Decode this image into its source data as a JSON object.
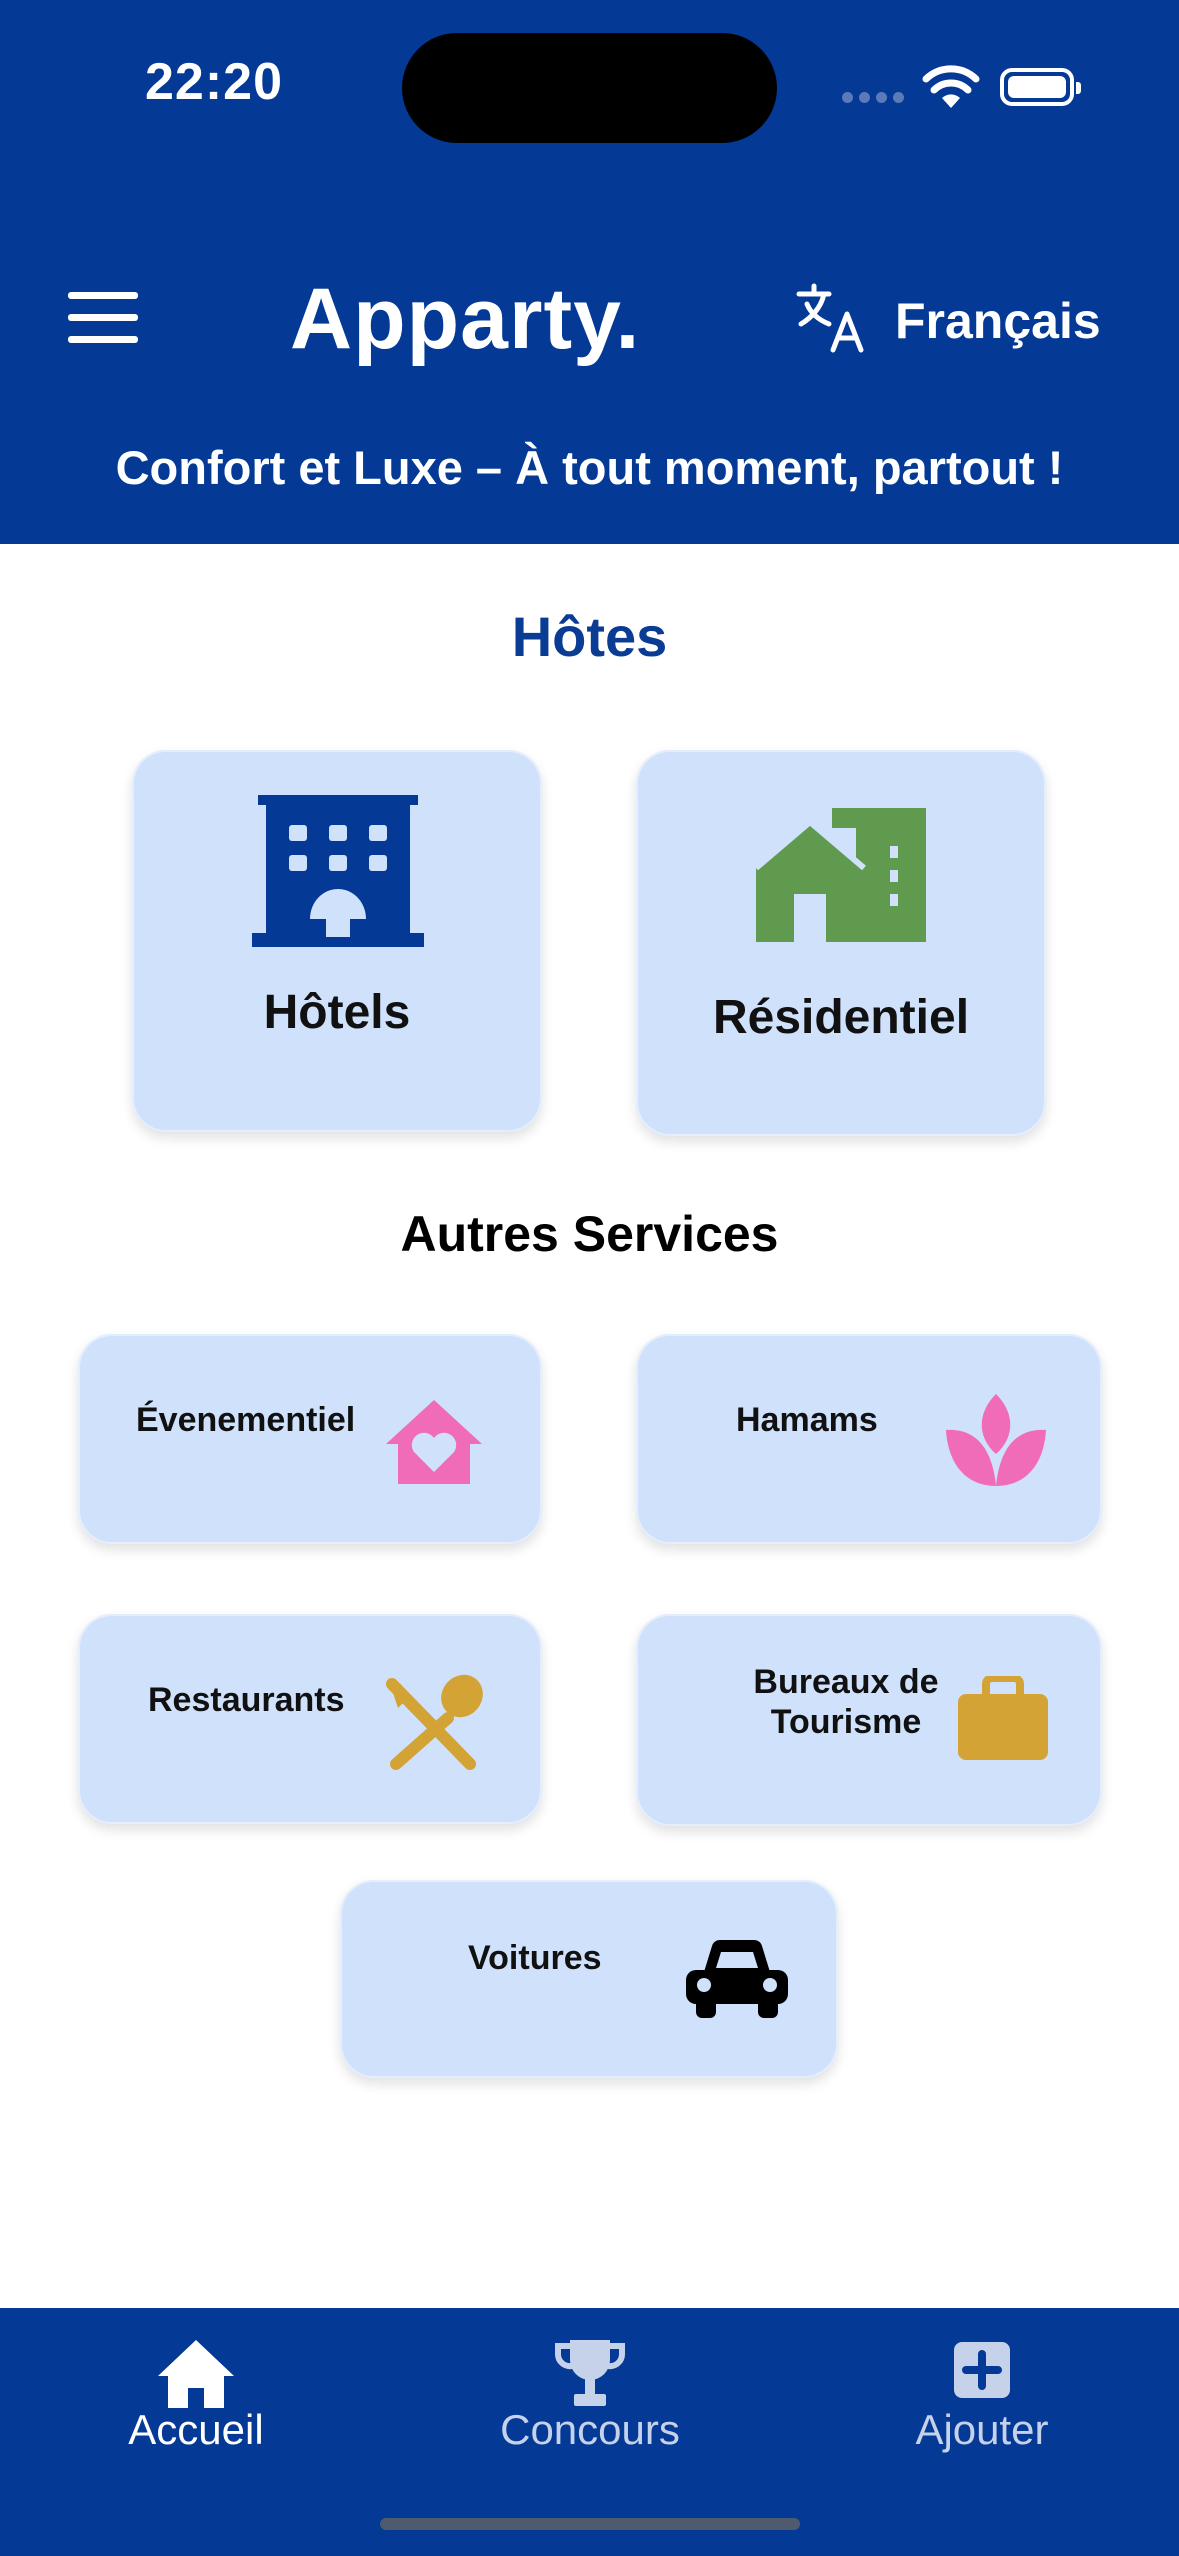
{
  "status_bar": {
    "time": "22:20"
  },
  "header": {
    "brand": "Apparty.",
    "language": "Français",
    "tagline": "Confort et Luxe – À tout moment, partout !"
  },
  "hosts": {
    "title": "Hôtes",
    "items": [
      {
        "label": "Hôtels",
        "icon": "hotel-building-icon",
        "color": "#043996"
      },
      {
        "label": "Résidentiel",
        "icon": "residential-houses-icon",
        "color": "#5f9a4f"
      }
    ]
  },
  "services": {
    "title": "Autres Services",
    "items": [
      {
        "label": "Évenementiel",
        "icon": "house-heart-icon",
        "color": "#f06bb8"
      },
      {
        "label": "Hamams",
        "icon": "lotus-icon",
        "color": "#f06bb8"
      },
      {
        "label": "Restaurants",
        "icon": "utensils-icon",
        "color": "#d4a336"
      },
      {
        "label": "Bureaux de Tourisme",
        "icon": "briefcase-icon",
        "color": "#d4a336"
      },
      {
        "label": "Voitures",
        "icon": "car-icon",
        "color": "#000000"
      }
    ]
  },
  "tabbar": {
    "items": [
      {
        "label": "Accueil",
        "icon": "home-icon",
        "active": true
      },
      {
        "label": "Concours",
        "icon": "trophy-icon",
        "active": false
      },
      {
        "label": "Ajouter",
        "icon": "plus-square-icon",
        "active": false
      }
    ],
    "active_color": "#ffffff",
    "inactive_color": "#c5d2ea"
  },
  "colors": {
    "primary": "#043996",
    "card": "#cfe1fb"
  }
}
